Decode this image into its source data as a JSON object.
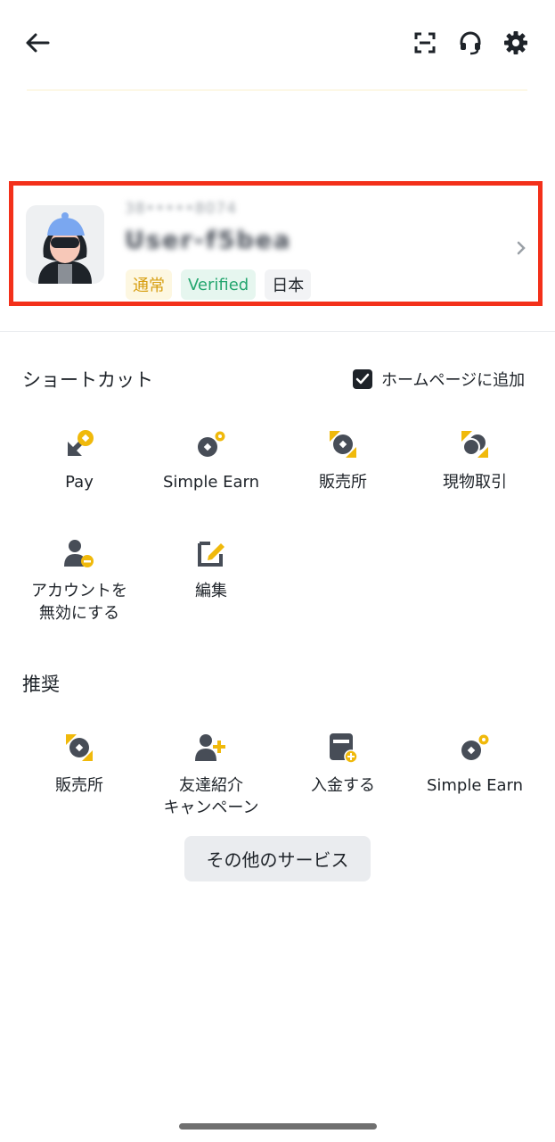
{
  "header": {
    "back_icon": "arrow-left-icon",
    "scan_icon": "scan-icon",
    "support_icon": "headset-icon",
    "settings_icon": "gear-icon"
  },
  "profile": {
    "user_id": "38•••••8074",
    "nickname": "User-f5bea",
    "badges": [
      "通常",
      "Verified",
      "日本"
    ],
    "colors": {
      "highlight_border": "#f3301a",
      "normal": "#d79f13",
      "verified": "#25a66f"
    }
  },
  "shortcuts": {
    "title": "ショートカット",
    "add_to_home": "ホームページに追加",
    "add_to_home_checked": true,
    "items": [
      {
        "label": "Pay",
        "icon": "pay-icon"
      },
      {
        "label": "Simple Earn",
        "icon": "simple-earn-icon"
      },
      {
        "label": "販売所",
        "icon": "convert-icon"
      },
      {
        "label": "現物取引",
        "icon": "spot-trade-icon"
      },
      {
        "label": "アカウントを\n無効にする",
        "icon": "disable-account-icon"
      },
      {
        "label": "編集",
        "icon": "edit-icon"
      }
    ]
  },
  "recommended": {
    "title": "推奨",
    "items": [
      {
        "label": "販売所",
        "icon": "convert-icon"
      },
      {
        "label": "友達紹介\nキャンペーン",
        "icon": "referral-icon"
      },
      {
        "label": "入金する",
        "icon": "deposit-icon"
      },
      {
        "label": "Simple Earn",
        "icon": "simple-earn-icon"
      }
    ]
  },
  "more_services": "その他のサービス",
  "theme": {
    "accent": "#f0b90b",
    "icon_dark": "#474d57"
  }
}
